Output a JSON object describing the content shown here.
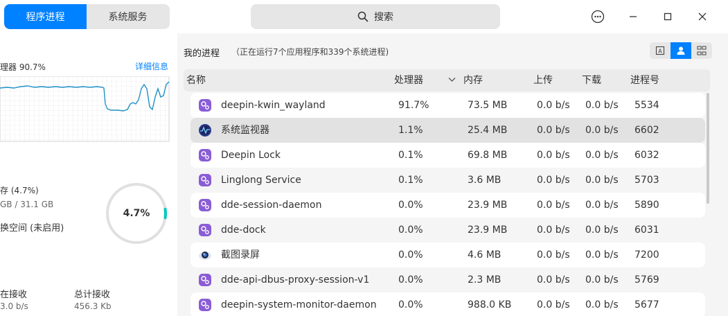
{
  "tabs": [
    {
      "label": "程序进程",
      "active": true
    },
    {
      "label": "系统服务",
      "active": false
    }
  ],
  "search": {
    "label": "搜索"
  },
  "window_controls": [
    "menu-icon",
    "minimize-icon",
    "maximize-icon",
    "close-icon"
  ],
  "left": {
    "cpu_label": "理器 90.7%",
    "detail_link": "详细信息",
    "memory_label": "存 (4.7%)",
    "memory_size": "GB / 31.1 GB",
    "swap_label": "换空间 (未启用)",
    "memory_percent_text": "4.7%",
    "memory_fraction": 0.047,
    "net_recv_label": "在接收",
    "net_recv_value": "3.0 b/s",
    "net_total_label": "总计接收",
    "net_total_value": "456.3 Kb"
  },
  "right": {
    "title": "我的进程",
    "summary": "（正在运行7个应用程序和339个系统进程)",
    "view_buttons": [
      "app-view-icon",
      "user-process-icon",
      "all-process-icon"
    ]
  },
  "table": {
    "headers": {
      "name": "名称",
      "cpu": "处理器",
      "mem": "内存",
      "up": "上传",
      "down": "下载",
      "pid": "进程号"
    },
    "rows": [
      {
        "name": "deepin-kwin_wayland",
        "cpu": "91.7%",
        "mem": "73.5 MB",
        "up": "0.0 b/s",
        "down": "0.0 b/s",
        "pid": "5534",
        "icon": "process-icon"
      },
      {
        "name": "系统监视器",
        "cpu": "1.1%",
        "mem": "25.4 MB",
        "up": "0.0 b/s",
        "down": "0.0 b/s",
        "pid": "6602",
        "icon": "system-monitor-icon"
      },
      {
        "name": "Deepin Lock",
        "cpu": "0.1%",
        "mem": "69.8 MB",
        "up": "0.0 b/s",
        "down": "0.0 b/s",
        "pid": "6032",
        "icon": "process-icon"
      },
      {
        "name": "Linglong Service",
        "cpu": "0.1%",
        "mem": "3.6 MB",
        "up": "0.0 b/s",
        "down": "0.0 b/s",
        "pid": "5703",
        "icon": "process-icon"
      },
      {
        "name": "dde-session-daemon",
        "cpu": "0.0%",
        "mem": "23.9 MB",
        "up": "0.0 b/s",
        "down": "0.0 b/s",
        "pid": "5890",
        "icon": "process-icon"
      },
      {
        "name": "dde-dock",
        "cpu": "0.0%",
        "mem": "23.9 MB",
        "up": "0.0 b/s",
        "down": "0.0 b/s",
        "pid": "6031",
        "icon": "process-icon"
      },
      {
        "name": "截图录屏",
        "cpu": "0.0%",
        "mem": "4.6 MB",
        "up": "0.0 b/s",
        "down": "0.0 b/s",
        "pid": "7200",
        "icon": "screenshot-icon"
      },
      {
        "name": "dde-api-dbus-proxy-session-v1",
        "cpu": "0.0%",
        "mem": "2.3 MB",
        "up": "0.0 b/s",
        "down": "0.0 b/s",
        "pid": "5769",
        "icon": "process-icon"
      },
      {
        "name": "deepin-system-monitor-daemon",
        "cpu": "0.0%",
        "mem": "988.0 KB",
        "up": "0.0 b/s",
        "down": "0.0 b/s",
        "pid": "5677",
        "icon": "process-icon"
      }
    ]
  },
  "colors": {
    "accent": "#0081ff",
    "graph_line": "#1e90c8",
    "ring_track": "#e0e0e0",
    "ring_fill": "#00c8c0"
  }
}
